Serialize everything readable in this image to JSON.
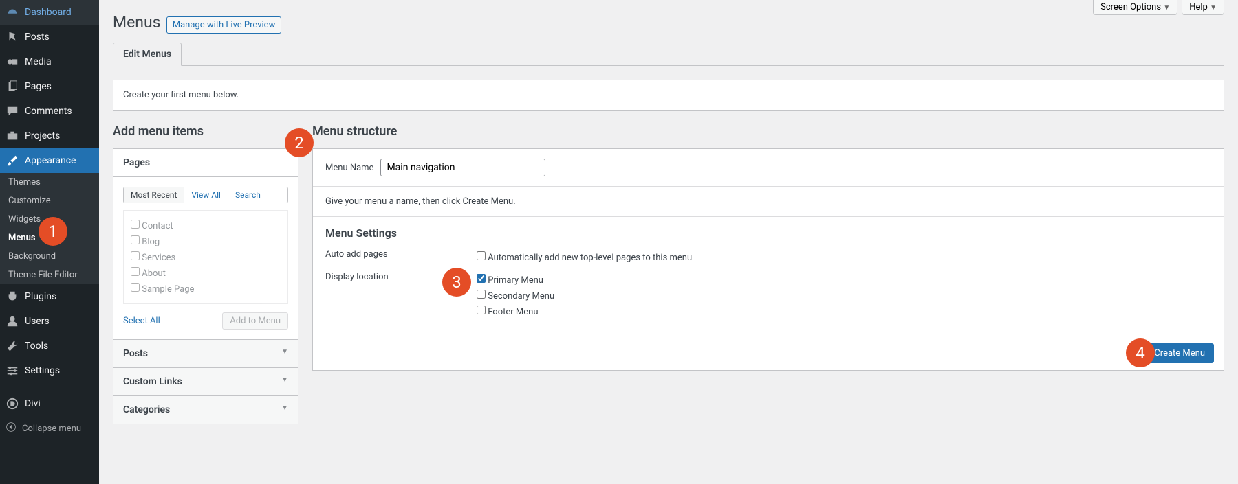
{
  "sidebar": {
    "items": [
      {
        "label": "Dashboard",
        "icon": "dashboard"
      },
      {
        "label": "Posts",
        "icon": "pin"
      },
      {
        "label": "Media",
        "icon": "media"
      },
      {
        "label": "Pages",
        "icon": "page"
      },
      {
        "label": "Comments",
        "icon": "comment"
      },
      {
        "label": "Projects",
        "icon": "portfolio"
      }
    ],
    "appearance_label": "Appearance",
    "sub": [
      {
        "label": "Themes"
      },
      {
        "label": "Customize"
      },
      {
        "label": "Widgets"
      },
      {
        "label": "Menus",
        "active": true
      },
      {
        "label": "Background"
      },
      {
        "label": "Theme File Editor"
      }
    ],
    "items2": [
      {
        "label": "Plugins",
        "icon": "plugin"
      },
      {
        "label": "Users",
        "icon": "user"
      },
      {
        "label": "Tools",
        "icon": "tool"
      },
      {
        "label": "Settings",
        "icon": "settings"
      }
    ],
    "divi_label": "Divi",
    "collapse_label": "Collapse menu"
  },
  "top": {
    "screen_options": "Screen Options",
    "help": "Help"
  },
  "header": {
    "title": "Menus",
    "live_preview": "Manage with Live Preview"
  },
  "tabs": {
    "edit": "Edit Menus"
  },
  "notice": "Create your first menu below.",
  "left": {
    "heading": "Add menu items",
    "pages_label": "Pages",
    "mini_tabs": {
      "recent": "Most Recent",
      "all": "View All",
      "search": "Search"
    },
    "pages_list": [
      "Contact",
      "Blog",
      "Services",
      "About",
      "Sample Page"
    ],
    "select_all": "Select All",
    "add_to_menu": "Add to Menu",
    "posts_label": "Posts",
    "custom_links_label": "Custom Links",
    "categories_label": "Categories"
  },
  "right": {
    "heading": "Menu structure",
    "name_label": "Menu Name",
    "name_value": "Main navigation",
    "desc": "Give your menu a name, then click Create Menu.",
    "settings_heading": "Menu Settings",
    "auto_add_label": "Auto add pages",
    "auto_add_opt": "Automatically add new top-level pages to this menu",
    "display_label": "Display location",
    "loc1": "Primary Menu",
    "loc2": "Secondary Menu",
    "loc3": "Footer Menu",
    "create_btn": "Create Menu"
  },
  "badges": {
    "b1": "1",
    "b2": "2",
    "b3": "3",
    "b4": "4"
  }
}
